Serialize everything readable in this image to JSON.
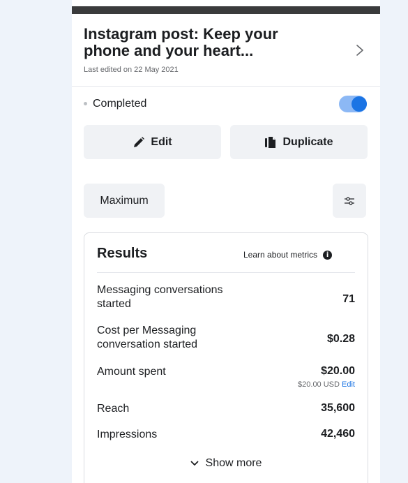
{
  "post": {
    "title": "Instagram post: Keep your phone and your heart...",
    "last_edited": "Last edited on 22 May 2021"
  },
  "status": {
    "label": "Completed",
    "toggle_on": true
  },
  "actions": {
    "edit_label": "Edit",
    "duplicate_label": "Duplicate"
  },
  "budget": {
    "selector_label": "Maximum"
  },
  "results": {
    "title": "Results",
    "learn_link": "Learn about metrics",
    "metrics": [
      {
        "label": "Messaging conversations started",
        "value": "71"
      },
      {
        "label": "Cost per Messaging conversation started",
        "value": "$0.28"
      },
      {
        "label": "Amount spent",
        "value": "$20.00",
        "sub": "$20.00 USD",
        "sub_link": "Edit"
      },
      {
        "label": "Reach",
        "value": "35,600"
      },
      {
        "label": "Impressions",
        "value": "42,460"
      }
    ],
    "show_more": "Show more"
  },
  "icons": {
    "chevron": "chevron-right-icon",
    "edit": "pencil-icon",
    "duplicate": "duplicate-icon",
    "filter": "sliders-icon",
    "info": "info-icon",
    "show_more": "chevron-down-icon"
  },
  "colors": {
    "accent": "#1b74e4",
    "button_bg": "#f0f2f5",
    "toggle_track": "#8cb8f5"
  }
}
